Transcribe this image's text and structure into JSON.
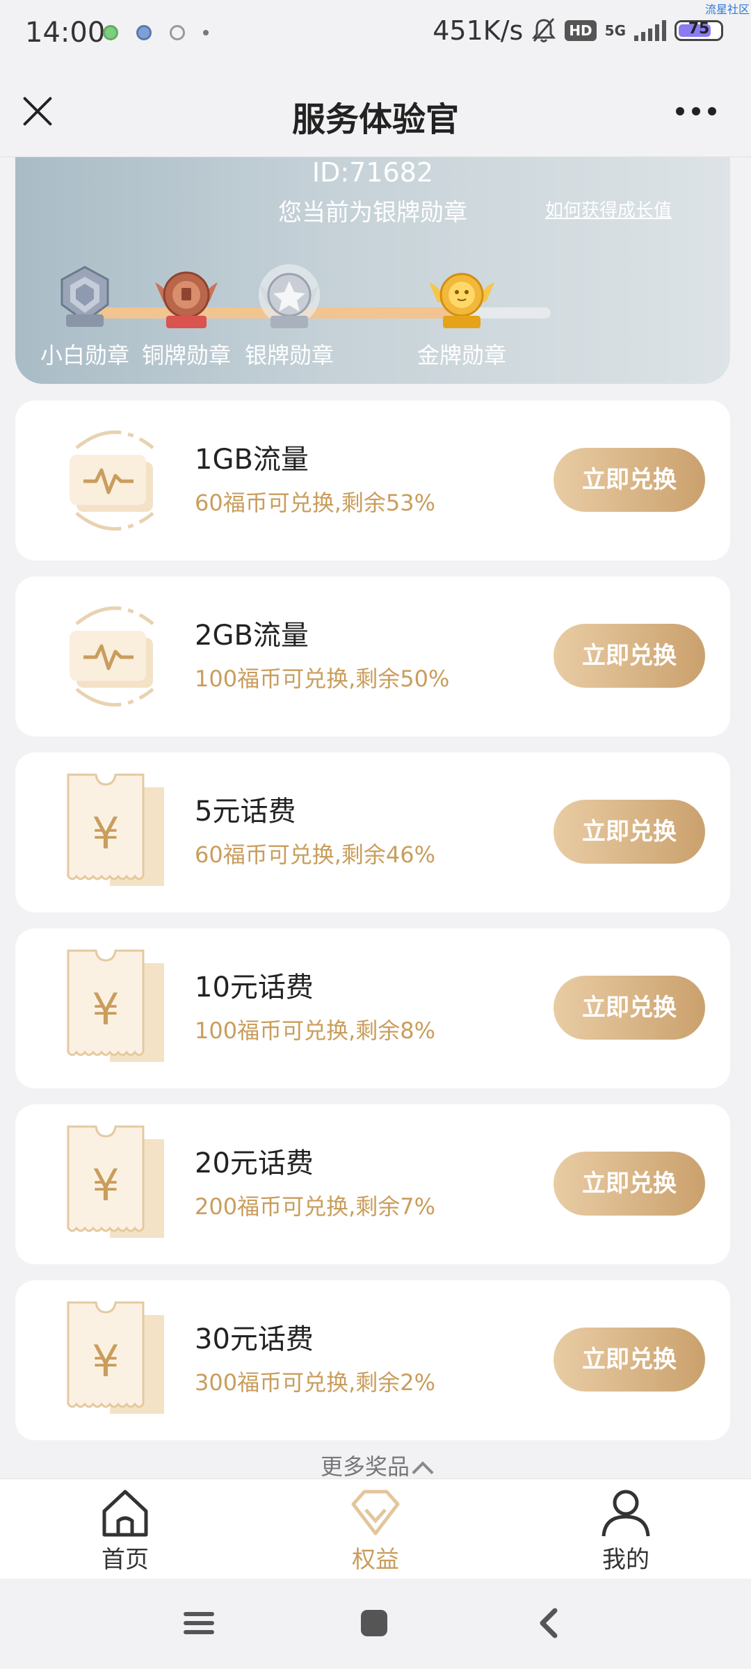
{
  "status_bar": {
    "time": "14:00",
    "net_speed": "451K/s",
    "hd": "HD",
    "network": "5G",
    "battery": "75",
    "corner_tag": "流星社区"
  },
  "navbar": {
    "title": "服务体验官"
  },
  "badge_panel": {
    "user_id": "ID:71682",
    "current_level": "您当前为银牌勋章",
    "growth_link": "如何获得成长值",
    "progress": 0.81,
    "medals": [
      {
        "label": "小白勋章",
        "tag": "小白",
        "color": "#9aa6b8"
      },
      {
        "label": "铜牌勋章",
        "tag": "铜牌",
        "color": "#b9664a"
      },
      {
        "label": "银牌勋章",
        "tag": "银牌",
        "color": "#c9ced6"
      },
      {
        "label": "金牌勋章",
        "tag": "金牌",
        "color": "#f2b83a"
      }
    ]
  },
  "prizes": [
    {
      "name": "1GB流量",
      "desc": "60福币可兑换,剩余53%",
      "icon": "data-traffic-icon",
      "button": "立即兑换"
    },
    {
      "name": "2GB流量",
      "desc": "100福币可兑换,剩余50%",
      "icon": "data-traffic-icon",
      "button": "立即兑换"
    },
    {
      "name": "5元话费",
      "desc": "60福币可兑换,剩余46%",
      "icon": "yuan-voucher-icon",
      "button": "立即兑换"
    },
    {
      "name": "10元话费",
      "desc": "100福币可兑换,剩余8%",
      "icon": "yuan-voucher-icon",
      "button": "立即兑换"
    },
    {
      "name": "20元话费",
      "desc": "200福币可兑换,剩余7%",
      "icon": "yuan-voucher-icon",
      "button": "立即兑换"
    },
    {
      "name": "30元话费",
      "desc": "300福币可兑换,剩余2%",
      "icon": "yuan-voucher-icon",
      "button": "立即兑换"
    }
  ],
  "more_prizes": "更多奖品",
  "tabbar": {
    "tabs": [
      {
        "label": "首页",
        "icon": "home-icon",
        "active": false
      },
      {
        "label": "权益",
        "icon": "diamond-icon",
        "active": true
      },
      {
        "label": "我的",
        "icon": "user-icon",
        "active": false
      }
    ]
  },
  "colors": {
    "accent": "#c99d5c",
    "button_start": "#e9cca4",
    "button_end": "#caa16d"
  }
}
